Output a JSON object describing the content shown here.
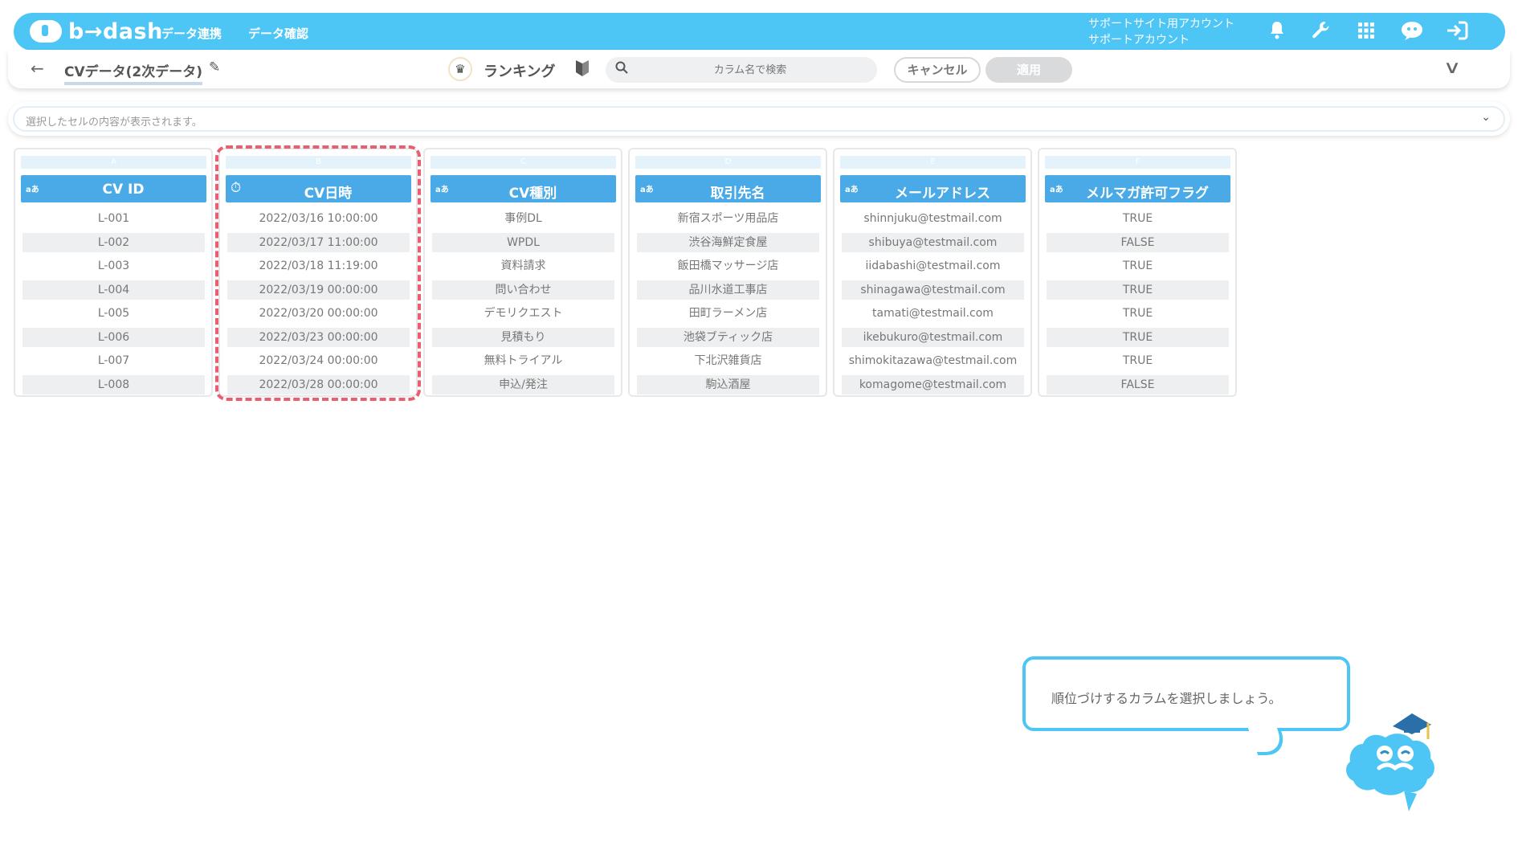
{
  "app": {
    "brand": "b→dash"
  },
  "nav": {
    "data_link": "データ連携",
    "data_check": "データ確認"
  },
  "account": {
    "line1": "サポートサイト用アカウント",
    "line2": "サポートアカウント"
  },
  "top_icons": [
    "bell-icon",
    "wrench-icon",
    "grid-icon",
    "chat-icon",
    "logout-icon"
  ],
  "toolbar": {
    "back": "←",
    "dataset_title": "CVデータ(2次データ)",
    "mode_label": "ランキング",
    "search_placeholder": "カラム名で検索",
    "cancel_label": "キャンセル",
    "apply_label": "適用"
  },
  "cell_bar": {
    "placeholder": "選択したセルの内容が表示されます。"
  },
  "columns": [
    {
      "letter": "A",
      "type": "aあ",
      "name": "CV ID",
      "cells": [
        "L-001",
        "L-002",
        "L-003",
        "L-004",
        "L-005",
        "L-006",
        "L-007",
        "L-008"
      ]
    },
    {
      "letter": "B",
      "type": "datetime",
      "name": "CV日時",
      "cells": [
        "2022/03/16 10:00:00",
        "2022/03/17 11:00:00",
        "2022/03/18 11:19:00",
        "2022/03/19 00:00:00",
        "2022/03/20 00:00:00",
        "2022/03/23 00:00:00",
        "2022/03/24 00:00:00",
        "2022/03/28 00:00:00"
      ]
    },
    {
      "letter": "C",
      "type": "aあ",
      "name": "CV種別",
      "cells": [
        "事例DL",
        "WPDL",
        "資料請求",
        "問い合わせ",
        "デモリクエスト",
        "見積もり",
        "無料トライアル",
        "申込/発注"
      ]
    },
    {
      "letter": "D",
      "type": "aあ",
      "name": "取引先名",
      "cells": [
        "新宿スポーツ用品店",
        "渋谷海鮮定食屋",
        "飯田橋マッサージ店",
        "品川水道工事店",
        "田町ラーメン店",
        "池袋ブティック店",
        "下北沢雑貨店",
        "駒込酒屋"
      ]
    },
    {
      "letter": "E",
      "type": "aあ",
      "name": "メールアドレス",
      "cells": [
        "shinnjuku@testmail.com",
        "shibuya@testmail.com",
        "iidabashi@testmail.com",
        "shinagawa@testmail.com",
        "tamati@testmail.com",
        "ikebukuro@testmail.com",
        "shimokitazawa@testmail.com",
        "komagome@testmail.com"
      ]
    },
    {
      "letter": "F",
      "type": "aあ",
      "name": "メルマガ許可フラグ",
      "cells": [
        "TRUE",
        "FALSE",
        "TRUE",
        "TRUE",
        "TRUE",
        "TRUE",
        "TRUE",
        "FALSE"
      ]
    }
  ],
  "tooltip": {
    "message": "順位づけするカラムを選択しましょう。"
  },
  "colors": {
    "brand": "#4ec6f5",
    "header": "#4aaae8",
    "highlight": "#ea5e72"
  }
}
